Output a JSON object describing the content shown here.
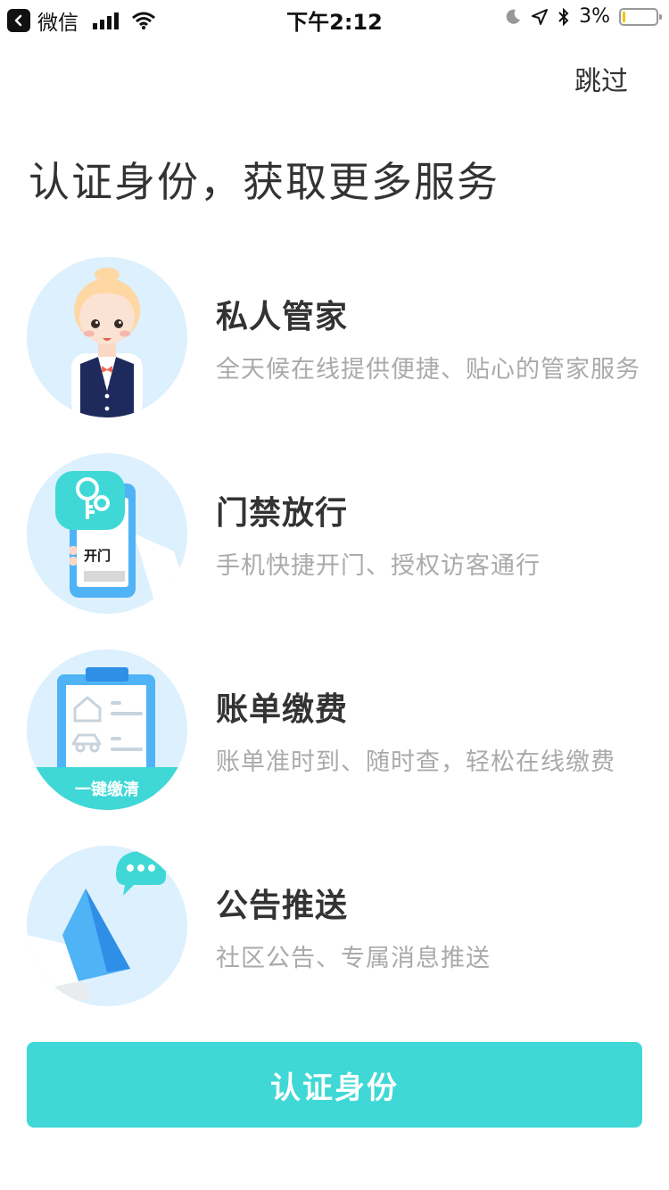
{
  "status_bar": {
    "app": "微信",
    "time": "下午2:12",
    "battery": "3%"
  },
  "header": {
    "skip_label": "跳过"
  },
  "headline": "认证身份，获取更多服务",
  "features": [
    {
      "icon": "butler-icon",
      "title": "私人管家",
      "desc": "全天候在线提供便捷、贴心的管家服务"
    },
    {
      "icon": "door-access-icon",
      "title": "门禁放行",
      "desc": "手机快捷开门、授权访客通行",
      "icon_text": "开门"
    },
    {
      "icon": "bill-icon",
      "title": "账单缴费",
      "desc": "账单准时到、随时查，轻松在线缴费",
      "icon_text": "一键缴清"
    },
    {
      "icon": "megaphone-icon",
      "title": "公告推送",
      "desc": "社区公告、专属消息推送"
    }
  ],
  "cta_label": "认证身份",
  "colors": {
    "accent": "#3fd8d6",
    "circle_bg": "#dcf0fd",
    "text_primary": "#333333",
    "text_secondary": "#aaaaaa"
  }
}
